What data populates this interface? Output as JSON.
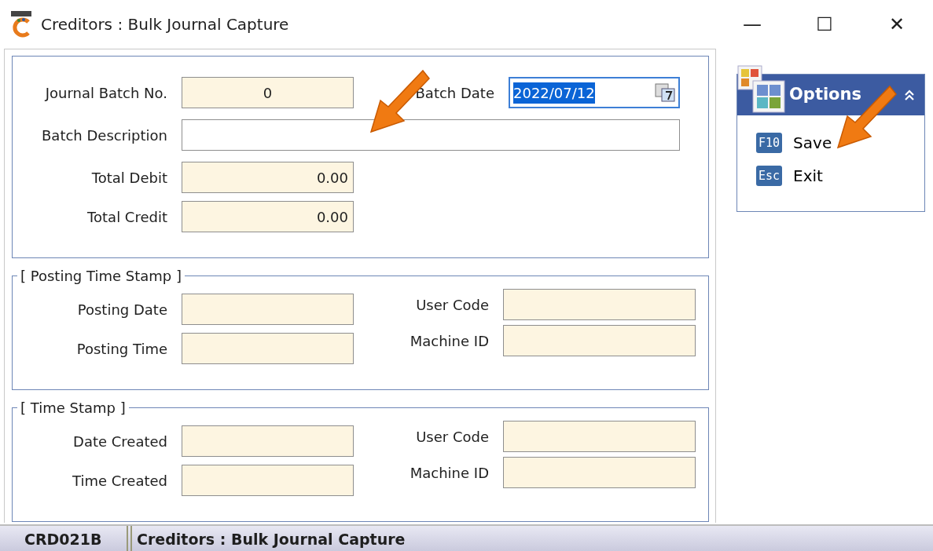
{
  "window": {
    "title": "Creditors : Bulk Journal Capture",
    "controls": [
      "—",
      "☐",
      "✕"
    ]
  },
  "batch": {
    "journal_batch_no": {
      "label": "Journal Batch No.",
      "value": "0"
    },
    "batch_date": {
      "label": "Batch Date",
      "value": "2022/07/12",
      "text_selected": true
    },
    "batch_description": {
      "label": "Batch Description"
    },
    "totals": [
      {
        "label": "Total Debit",
        "value": "0.00"
      },
      {
        "label": "Total Credit",
        "value": "0.00"
      }
    ]
  },
  "groups": [
    {
      "legend": "[ Posting Time Stamp ]",
      "left": [
        {
          "label": "Posting Date"
        },
        {
          "label": "Posting Time"
        }
      ],
      "right": [
        {
          "label": "User Code"
        },
        {
          "label": "Machine ID"
        }
      ]
    },
    {
      "legend": "[ Time Stamp ]",
      "left": [
        {
          "label": "Date Created"
        },
        {
          "label": "Time Created"
        }
      ],
      "right": [
        {
          "label": "User Code"
        },
        {
          "label": "Machine ID"
        }
      ]
    }
  ],
  "options": {
    "title": "Options",
    "expanded": true,
    "items": [
      {
        "key": "F10",
        "label": "Save"
      },
      {
        "key": "Esc",
        "label": "Exit"
      }
    ]
  },
  "status_bar": {
    "code": "CRD021B",
    "title": "Creditors : Bulk Journal Capture"
  }
}
